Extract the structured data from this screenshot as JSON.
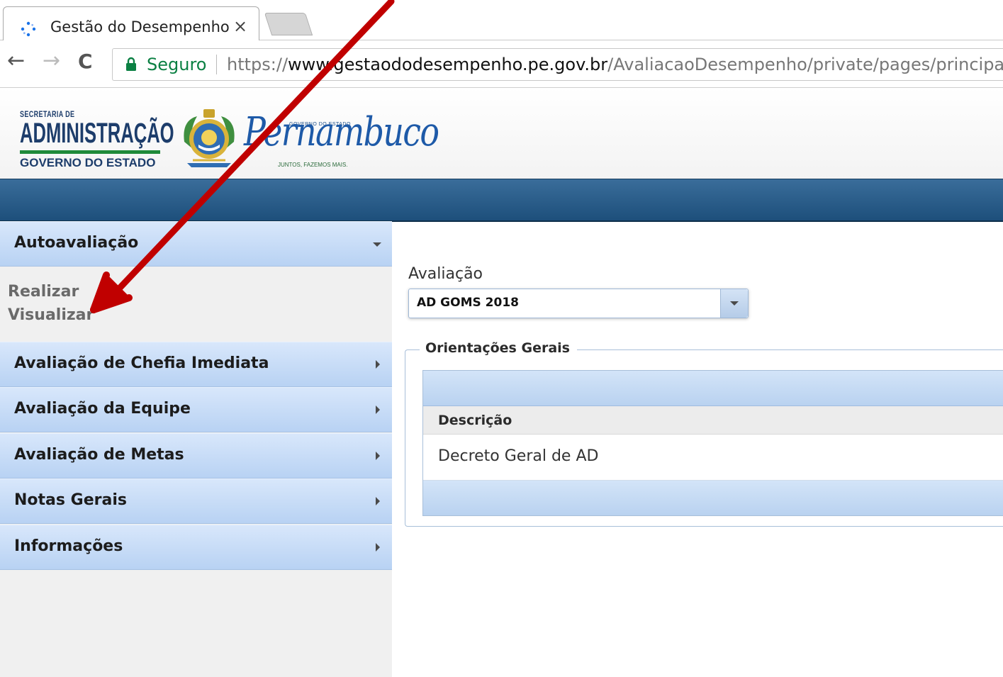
{
  "browser": {
    "tab_title": "Gestão do Desempenho",
    "tab_close": "×",
    "secure_label": "Seguro",
    "url_scheme": "https://",
    "url_host": "www.gestaododesempenho.pe.gov.br",
    "url_path": "/AvaliacaoDesempenho/private/pages/principal.jsf",
    "back_icon": "←",
    "forward_icon": "→",
    "reload_icon": "C"
  },
  "header": {
    "logo_secretaria": "SECRETARIA DE",
    "logo_administracao": "ADMINISTRAÇÃO",
    "logo_governo": "GOVERNO DO ESTADO",
    "logo_pe_top": "GOVERNO DO ESTADO",
    "logo_pe": "Pernambuco",
    "logo_pe_tagline": "JUNTOS, FAZEMOS MAIS."
  },
  "sidebar": {
    "sections": [
      {
        "label": "Autoavaliação",
        "expanded": true,
        "items": [
          "Realizar",
          "Visualizar"
        ]
      },
      {
        "label": "Avaliação de Chefia Imediata",
        "expanded": false
      },
      {
        "label": "Avaliação da Equipe",
        "expanded": false
      },
      {
        "label": "Avaliação de Metas",
        "expanded": false
      },
      {
        "label": "Notas Gerais",
        "expanded": false
      },
      {
        "label": "Informações",
        "expanded": false
      }
    ]
  },
  "main": {
    "avaliacao_label": "Avaliação",
    "avaliacao_selected": "AD GOMS 2018",
    "panel_legend": "Orientações Gerais",
    "table": {
      "columns": [
        "Descrição"
      ],
      "rows": [
        [
          "Decreto Geral de AD"
        ]
      ]
    }
  },
  "colors": {
    "header_bar": "#1d4f7b",
    "accordion": "#b8d2f3",
    "secure_green": "#0b8043",
    "annotation_arrow": "#c00000"
  }
}
